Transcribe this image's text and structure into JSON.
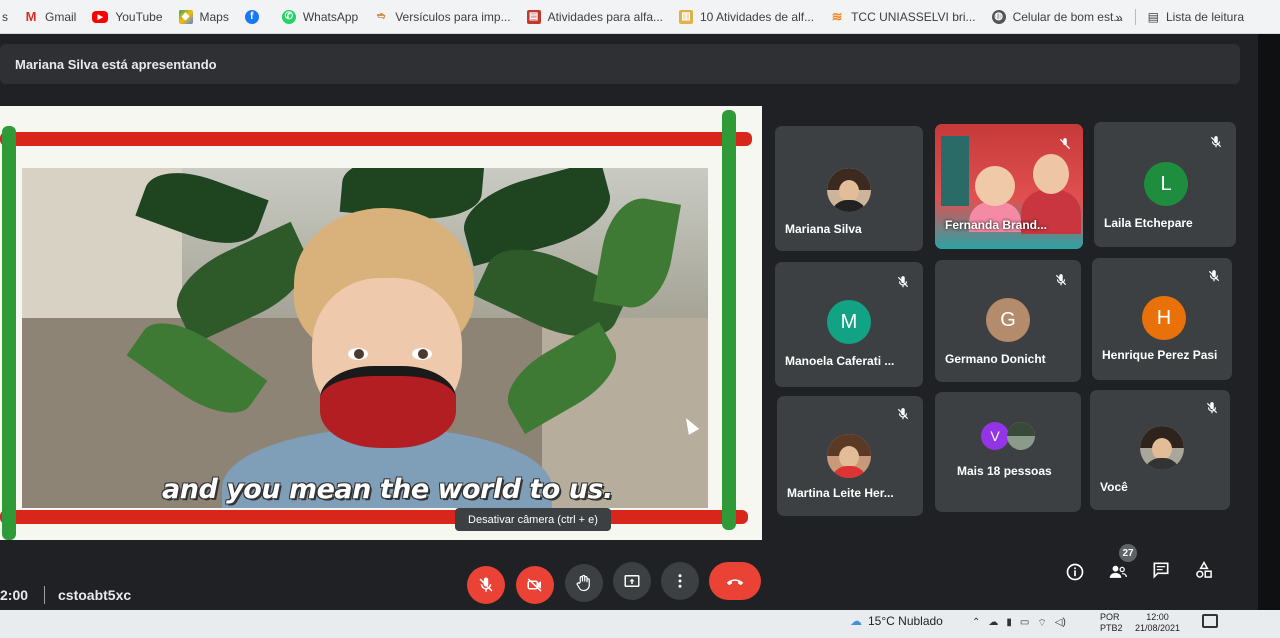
{
  "bookmarks": [
    {
      "label": "s",
      "icon": "truncated"
    },
    {
      "label": "Gmail",
      "icon": "gmail-icon",
      "color": "#d93025"
    },
    {
      "label": "YouTube",
      "icon": "youtube-icon",
      "color": "#ff0000"
    },
    {
      "label": "Maps",
      "icon": "maps-icon",
      "color": "#34a853"
    },
    {
      "label": "",
      "icon": "facebook-icon",
      "color": "#1877f2"
    },
    {
      "label": "WhatsApp",
      "icon": "whatsapp-icon",
      "color": "#25d366"
    },
    {
      "label": "Versículos para imp...",
      "icon": "page-icon",
      "color": "#c58a3a"
    },
    {
      "label": "Atividades para alfa...",
      "icon": "stack-icon",
      "color": "#c0392b"
    },
    {
      "label": "10 Atividades de alf...",
      "icon": "book-icon",
      "color": "#e0b14b"
    },
    {
      "label": "TCC UNIASSELVI bri...",
      "icon": "layers-icon",
      "color": "#f08a24"
    },
    {
      "label": "Celular de bom est...",
      "icon": "globe-icon",
      "color": "#555555"
    }
  ],
  "bookmarks_more": "»",
  "reading_list": "Lista de leitura",
  "presenter_text": "Mariana Silva está apresentando",
  "presentation": {
    "caption": "and you mean the world to us."
  },
  "tiles": {
    "t1": {
      "name": "Mariana Silva",
      "type": "photo"
    },
    "t2": {
      "name": "Fernanda Brand...",
      "type": "video"
    },
    "t3": {
      "name": "Laila Etchepare",
      "letter": "L",
      "color": "#1e8e3e"
    },
    "t4": {
      "name": "Manoela Caferati ...",
      "letter": "M",
      "color": "#12a385"
    },
    "t5": {
      "name": "Germano Donicht",
      "letter": "G",
      "color": "#b48b6b"
    },
    "t6": {
      "name": "Henrique Perez Pasi",
      "letter": "H",
      "color": "#e8710a"
    },
    "t7": {
      "name": "Martina Leite Her...",
      "type": "photo"
    },
    "t8": {
      "name": "Mais 18 pessoas",
      "letter": "V",
      "color": "#9334e6"
    },
    "t9": {
      "name": "Você",
      "type": "photo"
    }
  },
  "tooltip": "Desativar câmera (ctrl + e)",
  "clock": "2:00",
  "meeting_code": "cstoabt5xc",
  "controls": [
    "mic-off-icon",
    "camera-off-icon",
    "raise-hand-icon",
    "present-icon",
    "more-icon",
    "hangup-icon"
  ],
  "participants_count": "27",
  "taskbar": {
    "weather": "15°C  Nublado",
    "lang_top": "POR",
    "lang_bottom": "PTB2",
    "time": "12:00",
    "date": "21/08/2021"
  }
}
